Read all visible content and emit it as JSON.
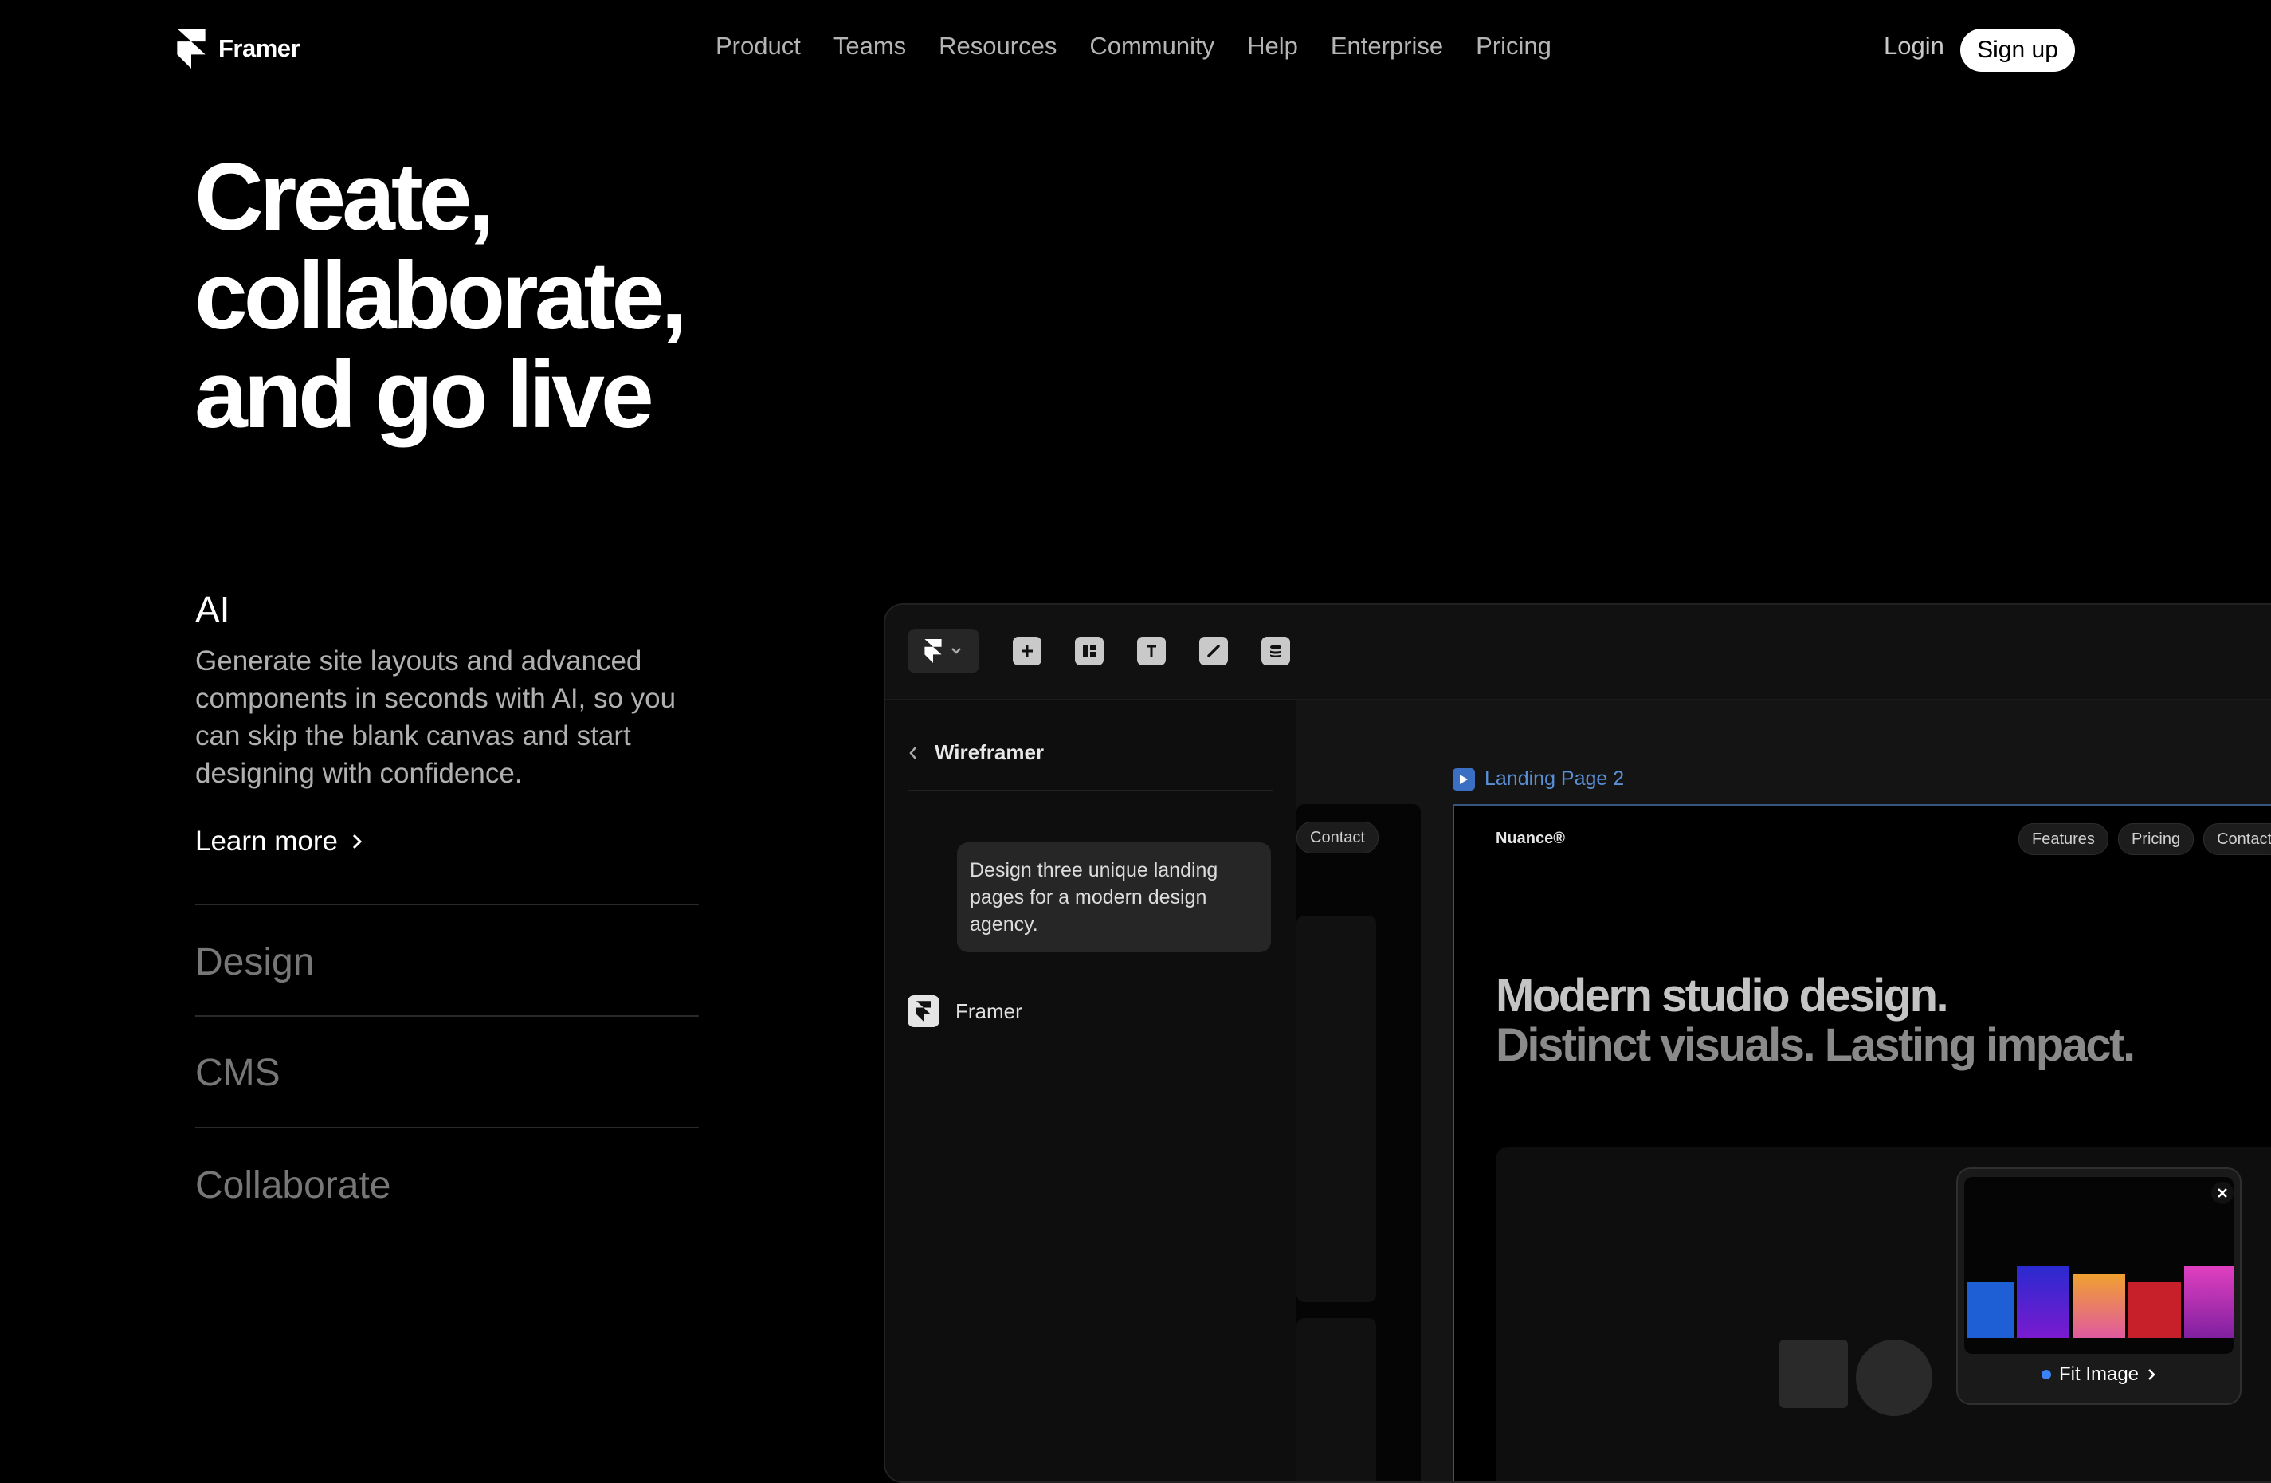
{
  "nav": {
    "logo_text": "Framer",
    "items": [
      "Product",
      "Teams",
      "Resources",
      "Community",
      "Help",
      "Enterprise",
      "Pricing"
    ],
    "login": "Login",
    "signup": "Sign up"
  },
  "hero": {
    "title": "Create,\ncollaborate,\nand go live"
  },
  "features": {
    "active_title": "AI",
    "active_description": "Generate site layouts and advanced components in seconds with AI, so you can skip the blank canvas and start designing with confidence.",
    "learn_more": "Learn more",
    "items": [
      "Design",
      "CMS",
      "Collaborate"
    ]
  },
  "app": {
    "toolbar_icons": [
      "framer-menu-icon",
      "plus-icon",
      "layout-icon",
      "text-icon",
      "brush-icon",
      "database-icon"
    ],
    "sidebar": {
      "title": "Wireframer",
      "prompt": "Design three unique landing pages for a modern design agency.",
      "assistant": "Framer"
    },
    "canvas": {
      "left_frame_pill": "Contact",
      "frame_label": "Landing Page 2",
      "brand": "Nuance®",
      "nav_pills": [
        "Features",
        "Pricing",
        "Contact"
      ],
      "headline_1": "Modern studio design.",
      "headline_2": "Distinct visuals. Lasting impact."
    },
    "popup": {
      "action": "Fit Image",
      "accent": "#3b82f6"
    }
  }
}
